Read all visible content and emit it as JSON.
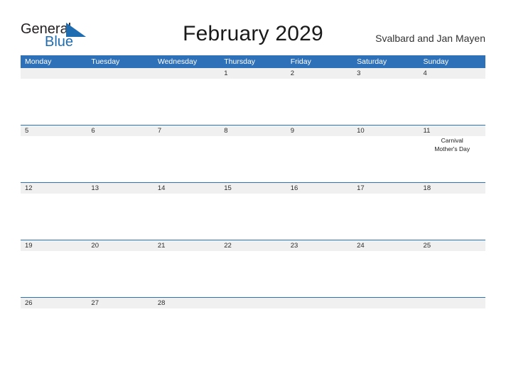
{
  "brand": {
    "general": "General",
    "blue": "Blue",
    "flag_icon": "triangle-flag-icon"
  },
  "header": {
    "title": "February 2029",
    "region": "Svalbard and Jan Mayen"
  },
  "calendar": {
    "weekdays": [
      "Monday",
      "Tuesday",
      "Wednesday",
      "Thursday",
      "Friday",
      "Saturday",
      "Sunday"
    ],
    "weeks": [
      {
        "days": [
          {
            "date": "",
            "events": []
          },
          {
            "date": "",
            "events": []
          },
          {
            "date": "",
            "events": []
          },
          {
            "date": "1",
            "events": []
          },
          {
            "date": "2",
            "events": []
          },
          {
            "date": "3",
            "events": []
          },
          {
            "date": "4",
            "events": []
          }
        ]
      },
      {
        "days": [
          {
            "date": "5",
            "events": []
          },
          {
            "date": "6",
            "events": []
          },
          {
            "date": "7",
            "events": []
          },
          {
            "date": "8",
            "events": []
          },
          {
            "date": "9",
            "events": []
          },
          {
            "date": "10",
            "events": []
          },
          {
            "date": "11",
            "events": [
              "Carnival",
              "Mother's Day"
            ]
          }
        ]
      },
      {
        "days": [
          {
            "date": "12",
            "events": []
          },
          {
            "date": "13",
            "events": []
          },
          {
            "date": "14",
            "events": []
          },
          {
            "date": "15",
            "events": []
          },
          {
            "date": "16",
            "events": []
          },
          {
            "date": "17",
            "events": []
          },
          {
            "date": "18",
            "events": []
          }
        ]
      },
      {
        "days": [
          {
            "date": "19",
            "events": []
          },
          {
            "date": "20",
            "events": []
          },
          {
            "date": "21",
            "events": []
          },
          {
            "date": "22",
            "events": []
          },
          {
            "date": "23",
            "events": []
          },
          {
            "date": "24",
            "events": []
          },
          {
            "date": "25",
            "events": []
          }
        ]
      },
      {
        "days": [
          {
            "date": "26",
            "events": []
          },
          {
            "date": "27",
            "events": []
          },
          {
            "date": "28",
            "events": []
          },
          {
            "date": "",
            "events": []
          },
          {
            "date": "",
            "events": []
          },
          {
            "date": "",
            "events": []
          },
          {
            "date": "",
            "events": []
          }
        ]
      }
    ]
  },
  "colors": {
    "header_blue": "#2e71b8",
    "brand_blue": "#1f6cb0",
    "date_band": "#f0f0f0",
    "page_background": "#ffffff"
  }
}
